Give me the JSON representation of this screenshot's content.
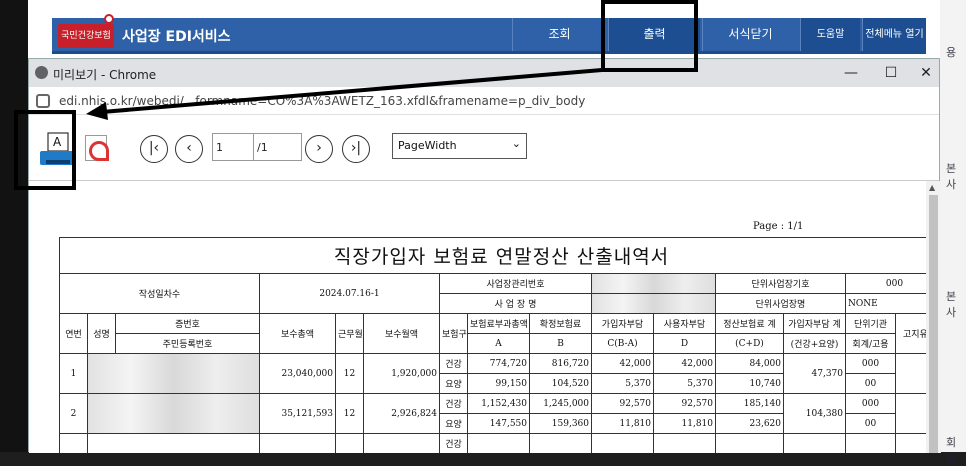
{
  "portal": {
    "logo_text": "국민건강보험",
    "service_title": "사업장 EDI서비스",
    "nav": [
      "조회",
      "출력",
      "서식닫기",
      "도움말",
      "전체메뉴 열기"
    ]
  },
  "window": {
    "title": "미리보기 - Chrome",
    "url": "edi.nhis.o.kr/webedi/...formname=CO%3A%3AWETZ_163.xfdl&framename=p_div_body"
  },
  "viewer": {
    "page_input": "1",
    "page_total": "/1",
    "zoom_selected": "PageWidth"
  },
  "report": {
    "page_label": "Page : 1/1",
    "title": "직장가입자 보험료 연말정산 산출내역서",
    "labels": {
      "작성일차수": "작성일차수",
      "사업장관리번호": "사업장관리번호",
      "사업장명": "사 업 장 명",
      "단위사업장기호": "단위사업장기호",
      "단위사업장명": "단위사업장명"
    },
    "values": {
      "작성일차수": "2024.07.16-1",
      "단위사업장기호": "000",
      "단위사업장명": "NONE"
    },
    "headers": {
      "연번": "연번",
      "성명": "성명",
      "증번호": "증번호",
      "주민등록번호": "주민등록번호",
      "보수총액": "보수총액",
      "근무월수": "근무월수",
      "보수월액": "보수월액",
      "보험구분": "보험구분",
      "보험료부과총액": "보험료부과총액",
      "A": "A",
      "확정보험료": "확정보험료",
      "B": "B",
      "가입자부담": "가입자부담",
      "가입자부담_sub": "C(B-A)",
      "사용자부담": "사용자부담",
      "D": "D",
      "정산보험료계": "정산보험료 계",
      "정산보험료계_sub": "(C+D)",
      "가입자부담계": "가입자부담 계",
      "가입자부담계_sub": "(건강+요양)",
      "단위기관": "단위기관",
      "회계구분": "회계/고용",
      "고지유예": "고지유예"
    },
    "rows": [
      {
        "no": "1",
        "total_pay": "23,040,000",
        "months": "12",
        "monthly_pay": "1,920,000",
        "sub": [
          {
            "kind": "건강",
            "a": "774,720",
            "b": "816,720",
            "c": "42,000",
            "d": "42,000",
            "cd": "84,000"
          },
          {
            "kind": "요양",
            "a": "99,150",
            "b": "104,520",
            "c": "5,370",
            "d": "5,370",
            "cd": "10,740"
          }
        ],
        "member_total": "47,370",
        "unit": [
          "000",
          "00"
        ]
      },
      {
        "no": "2",
        "total_pay": "35,121,593",
        "months": "12",
        "monthly_pay": "2,926,824",
        "sub": [
          {
            "kind": "건강",
            "a": "1,152,430",
            "b": "1,245,000",
            "c": "92,570",
            "d": "92,570",
            "cd": "185,140"
          },
          {
            "kind": "요양",
            "a": "147,550",
            "b": "159,360",
            "c": "11,810",
            "d": "11,810",
            "cd": "23,620"
          }
        ],
        "member_total": "104,380",
        "unit": [
          "000",
          "00"
        ]
      }
    ],
    "row3_kind": "건강"
  },
  "side_text": [
    "본사",
    "본사",
    "용",
    "회원"
  ]
}
